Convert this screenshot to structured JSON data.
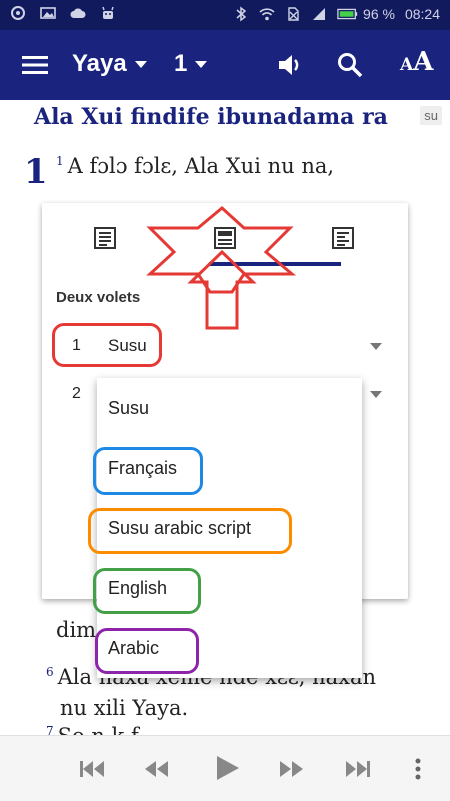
{
  "status_bar": {
    "battery": "96 %",
    "time": "08:24"
  },
  "app_bar": {
    "book": "Yaya",
    "chapter": "1",
    "text_size_small": "A",
    "text_size_big": "A"
  },
  "content": {
    "section_title": "Ala Xui findife ibunadama ra",
    "language_tag": "su",
    "chapter_number": "1",
    "verse1_number": "1",
    "verse1_text": "A fɔlɔ fɔlɛ, Ala Xui nu na,",
    "partial_line": "dim",
    "verse6_number": "6",
    "verse6_line1": "Ala naxa xeme nde xɛɛ, naxan",
    "verse6_line2": "nu xili Yaya.",
    "verse7_number": "7",
    "verse7_line": "So  n   k   f"
  },
  "layout_panel": {
    "heading": "Deux volets",
    "rows": [
      {
        "index": "1",
        "value": "Susu"
      },
      {
        "index": "2",
        "value": ""
      }
    ]
  },
  "dropdown": {
    "options": [
      "Susu",
      "Français",
      "Susu arabic script",
      "English",
      "Arabic"
    ]
  },
  "colors": {
    "app_bar": "#1a237e",
    "status_bar": "#121a5e",
    "annotation_red": "#e53935",
    "annotation_blue": "#1e88e5",
    "annotation_orange": "#fb8c00",
    "annotation_green": "#43a047",
    "annotation_purple": "#8e24aa"
  }
}
